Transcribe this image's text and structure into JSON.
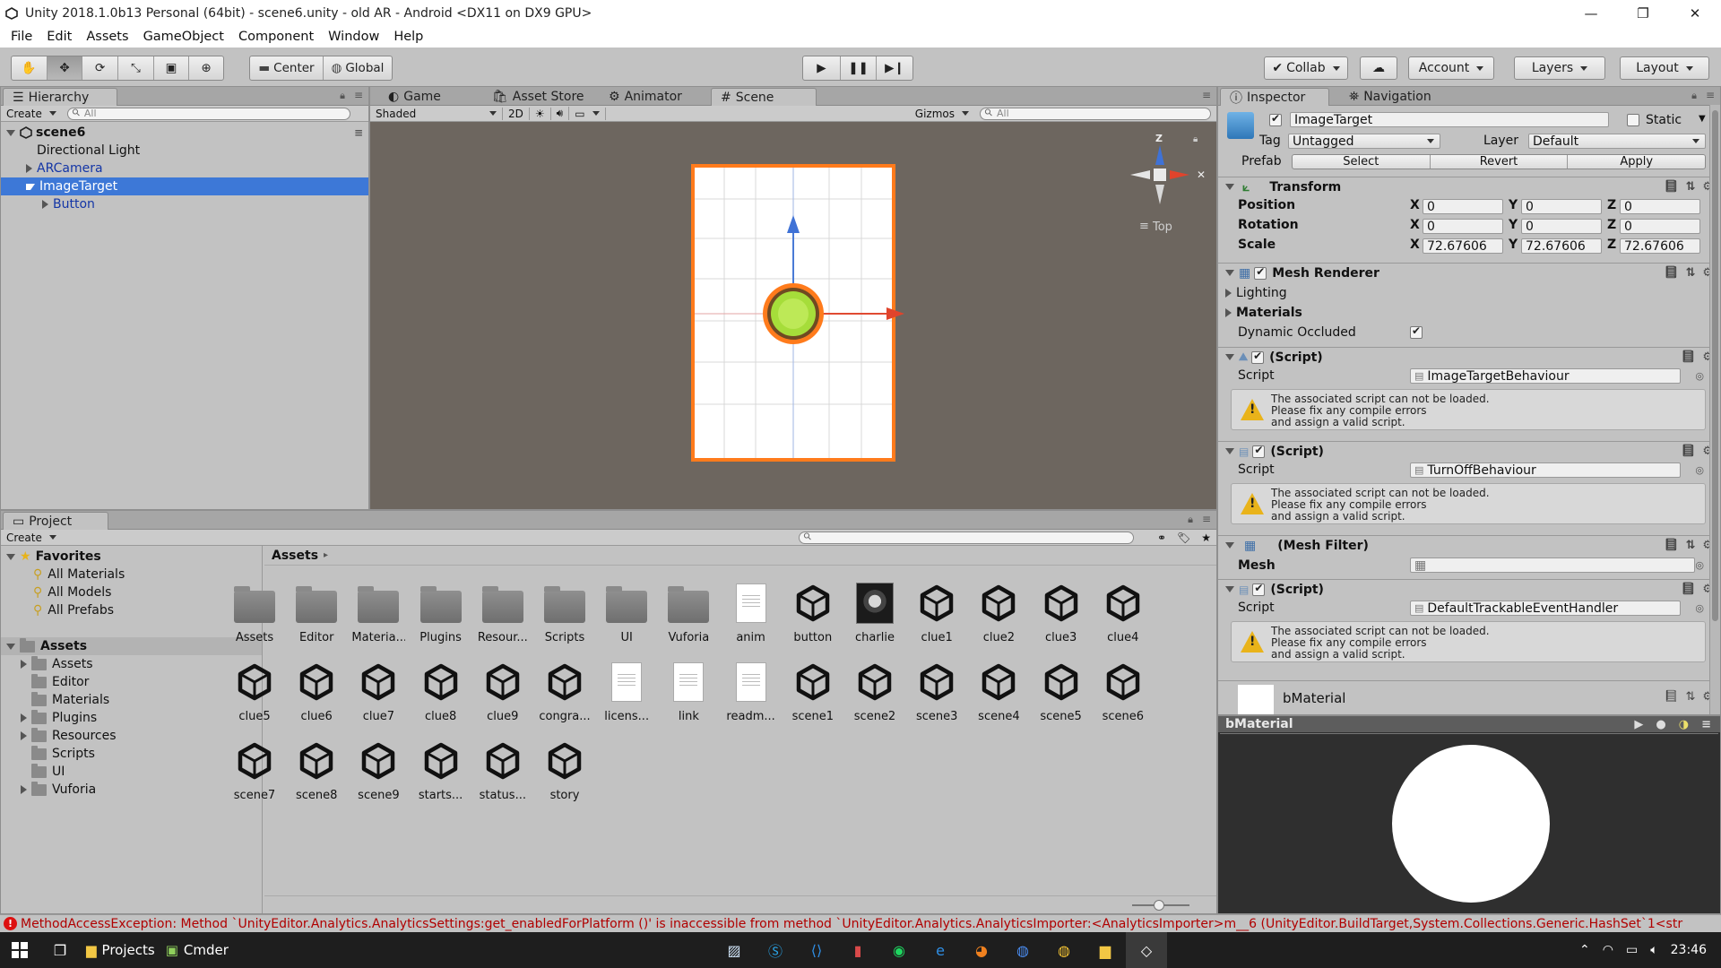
{
  "window": {
    "title": "Unity 2018.1.0b13 Personal (64bit) - scene6.unity - old AR - Android <DX11 on DX9 GPU>",
    "minimize": "—",
    "restore": "❐",
    "close": "✕"
  },
  "menu": [
    "File",
    "Edit",
    "Assets",
    "GameObject",
    "Component",
    "Window",
    "Help"
  ],
  "toolbar": {
    "pivot": "Center",
    "space": "Global",
    "collab": "Collab",
    "account": "Account",
    "layers": "Layers",
    "layout": "Layout",
    "active_tool": "move"
  },
  "hierarchy": {
    "tab": "Hierarchy",
    "create": "Create",
    "search_placeholder": "All",
    "scene": "scene6",
    "items": [
      {
        "label": "Directional Light",
        "indent": 1,
        "expandable": false,
        "prefab": false,
        "selected": false
      },
      {
        "label": "ARCamera",
        "indent": 1,
        "expandable": true,
        "expanded": false,
        "prefab": true,
        "selected": false
      },
      {
        "label": "ImageTarget",
        "indent": 1,
        "expandable": true,
        "expanded": true,
        "prefab": true,
        "selected": true
      },
      {
        "label": "Button",
        "indent": 2,
        "expandable": true,
        "expanded": false,
        "prefab": true,
        "selected": false
      }
    ]
  },
  "center_tabs": [
    "Game",
    "Asset Store",
    "Animator",
    "Scene"
  ],
  "scene": {
    "shading": "Shaded",
    "mode_2d": "2D",
    "gizmos": "Gizmos",
    "search_placeholder": "All",
    "orientation": "Top",
    "gizmo_axis": "Z",
    "background": "#6d665f"
  },
  "project": {
    "tab": "Project",
    "create": "Create",
    "breadcrumb": "Assets",
    "favorites_title": "Favorites",
    "favorites": [
      "All Materials",
      "All Models",
      "All Prefabs"
    ],
    "assets_root": "Assets",
    "folders": [
      {
        "label": "Assets",
        "expandable": true
      },
      {
        "label": "Editor",
        "expandable": false
      },
      {
        "label": "Materials",
        "expandable": false
      },
      {
        "label": "Plugins",
        "expandable": true
      },
      {
        "label": "Resources",
        "expandable": true
      },
      {
        "label": "Scripts",
        "expandable": false
      },
      {
        "label": "UI",
        "expandable": false
      },
      {
        "label": "Vuforia",
        "expandable": true
      }
    ],
    "assets": [
      {
        "label": "Assets",
        "kind": "folder"
      },
      {
        "label": "Editor",
        "kind": "folder"
      },
      {
        "label": "Materia...",
        "kind": "folder"
      },
      {
        "label": "Plugins",
        "kind": "folder"
      },
      {
        "label": "Resour...",
        "kind": "folder"
      },
      {
        "label": "Scripts",
        "kind": "folder"
      },
      {
        "label": "UI",
        "kind": "folder"
      },
      {
        "label": "Vuforia",
        "kind": "folder"
      },
      {
        "label": "anim",
        "kind": "doc"
      },
      {
        "label": "button",
        "kind": "unity"
      },
      {
        "label": "charlie",
        "kind": "image"
      },
      {
        "label": "clue1",
        "kind": "unity"
      },
      {
        "label": "clue2",
        "kind": "unity"
      },
      {
        "label": "clue3",
        "kind": "unity"
      },
      {
        "label": "clue4",
        "kind": "unity"
      },
      {
        "label": "clue5",
        "kind": "unity"
      },
      {
        "label": "clue6",
        "kind": "unity"
      },
      {
        "label": "clue7",
        "kind": "unity"
      },
      {
        "label": "clue8",
        "kind": "unity"
      },
      {
        "label": "clue9",
        "kind": "unity"
      },
      {
        "label": "congra...",
        "kind": "unity"
      },
      {
        "label": "licens...",
        "kind": "doc"
      },
      {
        "label": "link",
        "kind": "doc"
      },
      {
        "label": "readm...",
        "kind": "doc"
      },
      {
        "label": "scene1",
        "kind": "unity"
      },
      {
        "label": "scene2",
        "kind": "unity"
      },
      {
        "label": "scene3",
        "kind": "unity"
      },
      {
        "label": "scene4",
        "kind": "unity"
      },
      {
        "label": "scene5",
        "kind": "unity"
      },
      {
        "label": "scene6",
        "kind": "unity"
      },
      {
        "label": "scene7",
        "kind": "unity"
      },
      {
        "label": "scene8",
        "kind": "unity"
      },
      {
        "label": "scene9",
        "kind": "unity"
      },
      {
        "label": "starts...",
        "kind": "unity"
      },
      {
        "label": "status...",
        "kind": "unity"
      },
      {
        "label": "story",
        "kind": "unity"
      }
    ]
  },
  "inspector": {
    "tab": "Inspector",
    "tab2": "Navigation",
    "object_name": "ImageTarget",
    "static_label": "Static",
    "tag_label": "Tag",
    "tag_value": "Untagged",
    "layer_label": "Layer",
    "layer_value": "Default",
    "prefab_label": "Prefab",
    "prefab_select": "Select",
    "prefab_revert": "Revert",
    "prefab_apply": "Apply",
    "transform": {
      "title": "Transform",
      "position_label": "Position",
      "rotation_label": "Rotation",
      "scale_label": "Scale",
      "x": "X",
      "y": "Y",
      "z": "Z",
      "position": [
        "0",
        "0",
        "0"
      ],
      "rotation": [
        "0",
        "0",
        "0"
      ],
      "scale": [
        "72.67606",
        "72.67606",
        "72.67606"
      ]
    },
    "mesh_renderer": {
      "title": "Mesh Renderer",
      "lighting": "Lighting",
      "materials": "Materials",
      "dynamic_occluded": "Dynamic Occluded"
    },
    "scripts": [
      {
        "title": "(Script)",
        "script_label": "Script",
        "script_value": "ImageTargetBehaviour"
      },
      {
        "title": "(Script)",
        "script_label": "Script",
        "script_value": "TurnOffBehaviour"
      },
      {
        "title": "(Script)",
        "script_label": "Script",
        "script_value": "DefaultTrackableEventHandler"
      }
    ],
    "warning_line1": "The associated script can not be loaded.",
    "warning_line2": "Please fix any compile errors",
    "warning_line3": "and assign a valid script.",
    "mesh_filter": {
      "title": "(Mesh Filter)",
      "mesh_label": "Mesh"
    },
    "material_name": "bMaterial",
    "preview_title": "bMaterial"
  },
  "status": {
    "error": "MethodAccessException: Method `UnityEditor.Analytics.AnalyticsSettings:get_enabledForPlatform ()' is inaccessible from method `UnityEditor.Analytics.AnalyticsImporter:<AnalyticsImporter>m__6 (UnityEditor.BuildTarget,System.Collections.Generic.HashSet`1<str"
  },
  "taskbar": {
    "apps": [
      "Projects",
      "Cmder"
    ],
    "time": "23:46"
  }
}
